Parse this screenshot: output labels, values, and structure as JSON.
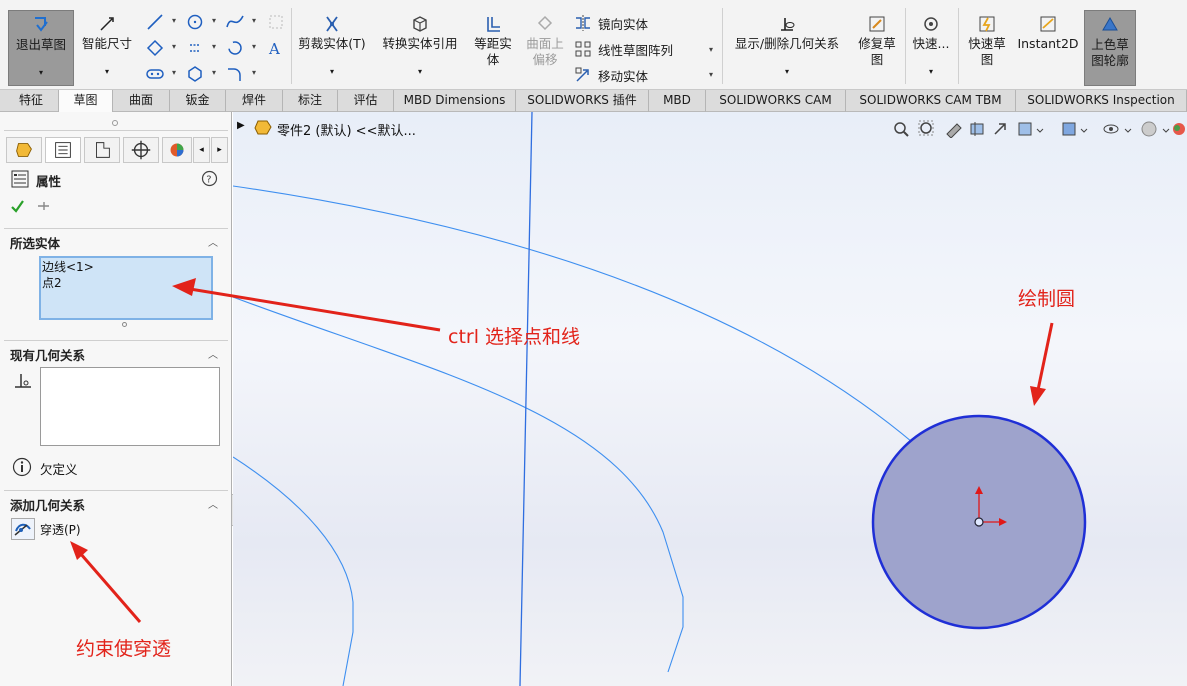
{
  "ribbon": {
    "exit_sketch": "退出草图",
    "smart_dimension": "智能尺寸",
    "trim": "剪裁实体(T)",
    "convert": "转换实体引用",
    "offset": "等距实\n体",
    "surface_offset": "曲面上\n偏移",
    "mirror": "镜向实体",
    "linear_pattern": "线性草图阵列",
    "move": "移动实体",
    "show_relations": "显示/删除几何关系",
    "repair": "修复草\n图",
    "quick_snaps": "快速...",
    "rapid_sketch": "快速草\n图",
    "instant2d": "Instant2D",
    "shaded_contours": "上色草\n图轮廓"
  },
  "tabs": [
    "特征",
    "草图",
    "曲面",
    "钣金",
    "焊件",
    "标注",
    "评估",
    "MBD Dimensions",
    "SOLIDWORKS 插件",
    "MBD",
    "SOLIDWORKS CAM",
    "SOLIDWORKS CAM TBM",
    "SOLIDWORKS Inspection"
  ],
  "panel": {
    "title": "属性",
    "selected_entities_header": "所选实体",
    "selected_items": [
      "边线<1>",
      "点2"
    ],
    "existing_relations_header": "现有几何关系",
    "status": "欠定义",
    "add_relations_header": "添加几何关系",
    "pierce_label": "穿透(P)"
  },
  "viewport": {
    "breadcrumb": "零件2 (默认) <<默认..."
  },
  "annotations": {
    "ctrl_select": "ctrl 选择点和线",
    "draw_circle": "绘制圆",
    "constrain_pierce": "约束使穿透"
  },
  "colors": {
    "circle_fill": "#9ea3cc",
    "circle_stroke": "#1f2fd6",
    "annotation_red": "#e2231a",
    "selection_box": "#cfe4f7"
  }
}
